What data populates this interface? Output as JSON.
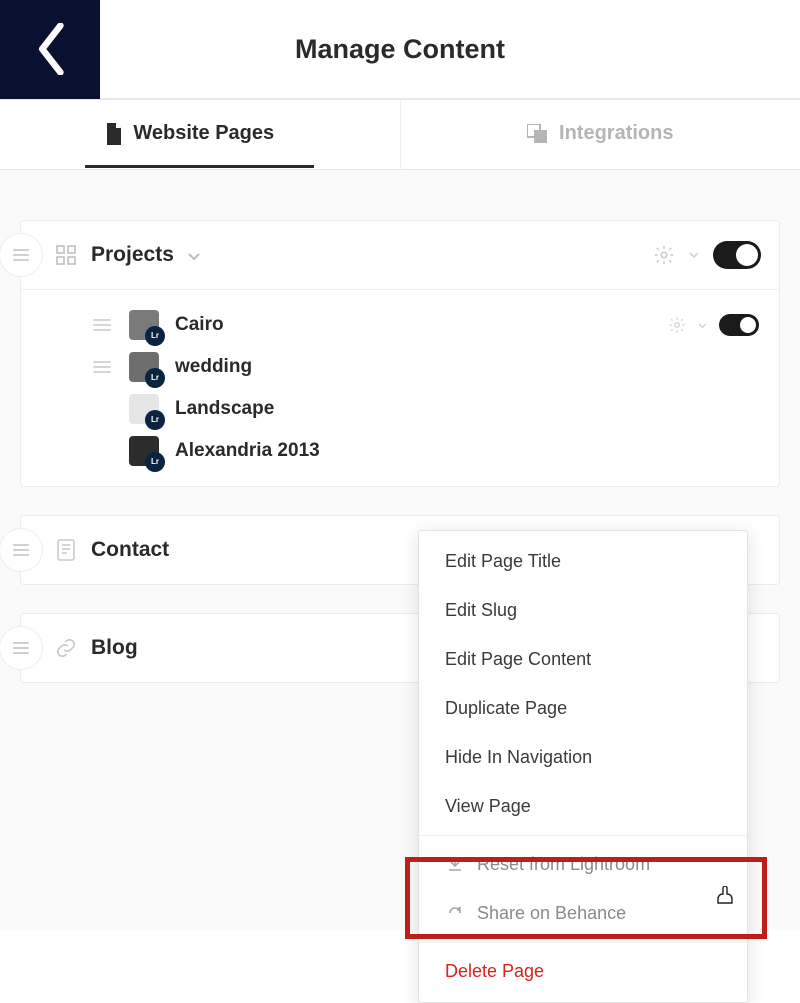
{
  "header": {
    "title": "Manage Content"
  },
  "tabs": [
    {
      "label": "Website Pages",
      "icon": "page-icon",
      "active": true
    },
    {
      "label": "Integrations",
      "icon": "integrations-icon",
      "active": false
    }
  ],
  "sections": {
    "projects": {
      "title": "Projects",
      "toggle_on": true,
      "items": [
        {
          "label": "Cairo",
          "lr": true
        },
        {
          "label": "wedding",
          "lr": true
        },
        {
          "label": "Landscape",
          "lr": true
        },
        {
          "label": "Alexandria 2013",
          "lr": true
        }
      ],
      "first_item_toggle_on": true
    },
    "contact": {
      "title": "Contact"
    },
    "blog": {
      "title": "Blog"
    }
  },
  "menu": {
    "items": [
      {
        "label": "Edit Page Title"
      },
      {
        "label": "Edit Slug"
      },
      {
        "label": "Edit Page Content"
      },
      {
        "label": "Duplicate Page"
      },
      {
        "label": "Hide In Navigation"
      },
      {
        "label": "View Page"
      }
    ],
    "reset": "Reset from Lightroom",
    "share": "Share on Behance",
    "delete": "Delete Page"
  }
}
